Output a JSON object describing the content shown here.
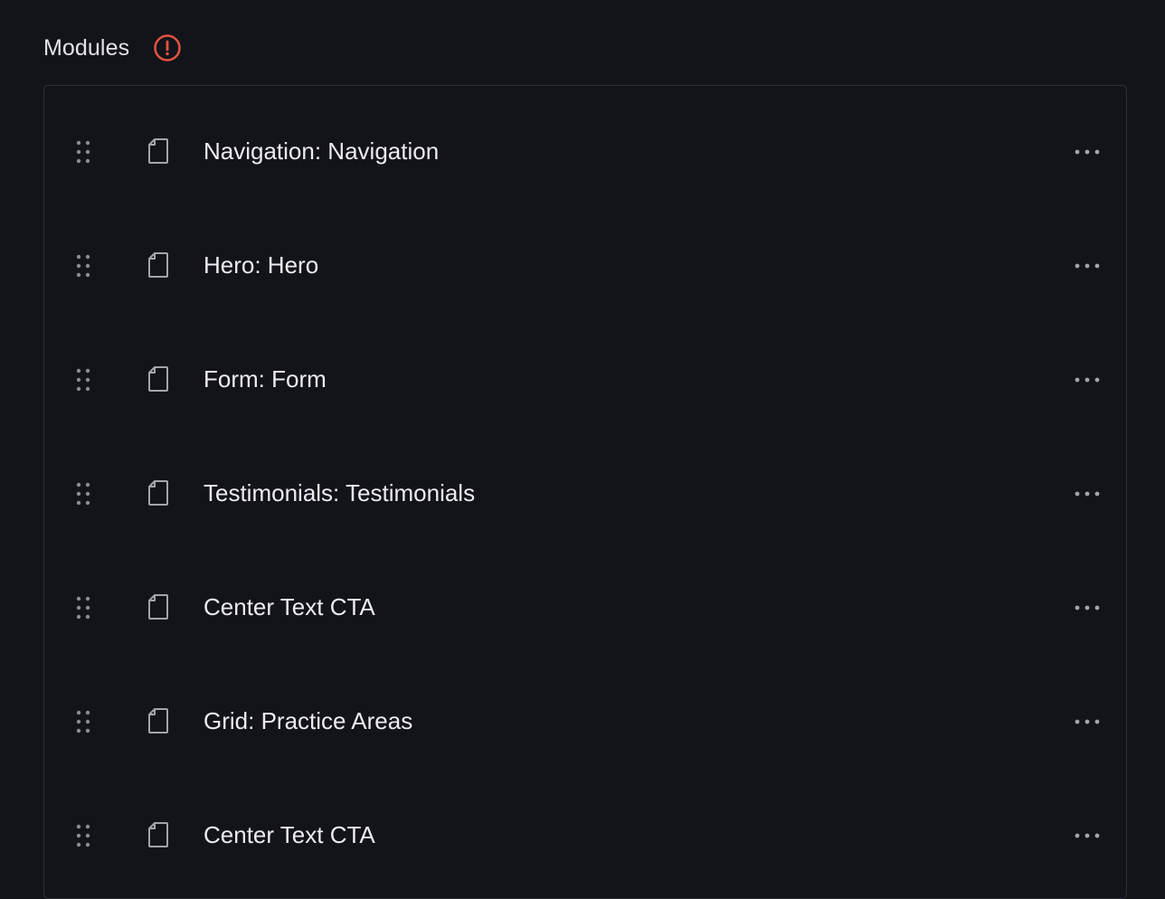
{
  "field": {
    "label": "Modules",
    "status_icon": "warning-circle-icon",
    "status_color": "#e5533d"
  },
  "modules": [
    {
      "title": "Navigation: Navigation"
    },
    {
      "title": "Hero: Hero"
    },
    {
      "title": "Form: Form"
    },
    {
      "title": "Testimonials: Testimonials"
    },
    {
      "title": "Center Text CTA"
    },
    {
      "title": "Grid: Practice Areas"
    },
    {
      "title": "Center Text CTA"
    }
  ],
  "icons": {
    "drag": "drag-handle-icon",
    "document": "document-icon",
    "menu": "more-horizontal-icon"
  }
}
